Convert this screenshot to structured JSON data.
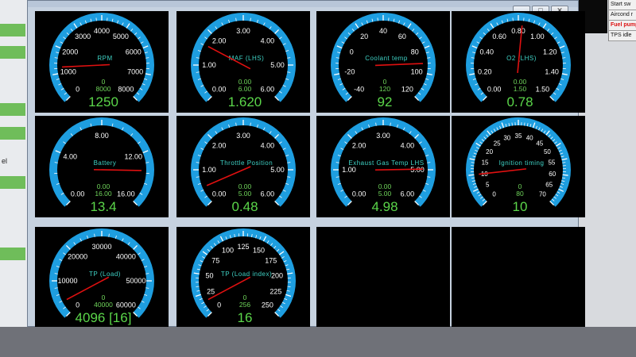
{
  "window": {
    "controls": {
      "minimize": "_",
      "maximize": "□",
      "close": "✕"
    }
  },
  "colors": {
    "gauge_ring": "#1e9ee0",
    "needle": "#e01010",
    "value_text": "#5bd64a",
    "minmax_text": "#6fd45a",
    "label_text": "#3fd3c6",
    "scale_text": "#ffffff",
    "tile_bg": "#000000"
  },
  "left_strip": {
    "items": [
      "",
      "",
      "",
      "",
      "el",
      "",
      "",
      ""
    ]
  },
  "right_table": {
    "rows": [
      {
        "text": "Start sw",
        "alert": false
      },
      {
        "text": "Aircond r",
        "alert": false
      },
      {
        "text": "Fuel pump",
        "alert": true
      },
      {
        "text": "TPS idle",
        "alert": false
      }
    ]
  },
  "gauges": [
    {
      "label": "RPM",
      "scale_labels": [
        "0",
        "1000",
        "2000",
        "3000",
        "4000",
        "5000",
        "6000",
        "7000",
        "8000"
      ],
      "min_text": "0",
      "max_text": "8000",
      "value_text": "1250",
      "min": 0,
      "max": 8000,
      "value": 1250
    },
    {
      "label": "MAF (LHS)",
      "scale_labels": [
        "0.00",
        "1.00",
        "2.00",
        "3.00",
        "4.00",
        "5.00",
        "6.00"
      ],
      "min_text": "0.00",
      "max_text": "6.00",
      "value_text": "1.620",
      "min": 0,
      "max": 6,
      "value": 1.62
    },
    {
      "label": "Coolant temp",
      "scale_labels": [
        "-40",
        "-20",
        "0",
        "20",
        "40",
        "60",
        "80",
        "100",
        "120"
      ],
      "min_text": "0",
      "max_text": "120",
      "value_text": "92",
      "min": -40,
      "max": 120,
      "value": 92
    },
    {
      "label": "O2 (LHS)",
      "scale_labels": [
        "0.00",
        "0.20",
        "0.40",
        "0.60",
        "0.80",
        "1.00",
        "1.20",
        "1.40",
        "1.50"
      ],
      "min_text": "0.00",
      "max_text": "1.50",
      "value_text": "0.78",
      "min": 0,
      "max": 1.5,
      "value": 0.78
    },
    {
      "label": "Battery",
      "scale_labels": [
        "0.00",
        "4.00",
        "8.00",
        "12.00",
        "16.00"
      ],
      "min_text": "0.00",
      "max_text": "16.00",
      "value_text": "13.4",
      "min": 0,
      "max": 16,
      "value": 13.4
    },
    {
      "label": "Throttle Position",
      "scale_labels": [
        "0.00",
        "1.00",
        "2.00",
        "3.00",
        "4.00",
        "5.00",
        "6.00"
      ],
      "min_text": "0.00",
      "max_text": "5.00",
      "value_text": "0.48",
      "min": 0,
      "max": 6,
      "value": 0.48
    },
    {
      "label": "Exhaust Gas Temp LHS",
      "scale_labels": [
        "0.00",
        "1.00",
        "2.00",
        "3.00",
        "4.00",
        "5.00",
        "6.00"
      ],
      "min_text": "0.00",
      "max_text": "5.00",
      "value_text": "4.98",
      "min": 0,
      "max": 6,
      "value": 4.98
    },
    {
      "label": "Ignition timing",
      "scale_labels": [
        "0",
        "5",
        "10",
        "15",
        "20",
        "25",
        "30",
        "35",
        "40",
        "45",
        "50",
        "55",
        "60",
        "65",
        "70"
      ],
      "min_text": "0",
      "max_text": "80",
      "value_text": "10",
      "min": 0,
      "max": 70,
      "value": 10
    },
    {
      "label": "TP (Load)",
      "scale_labels": [
        "0",
        "10000",
        "20000",
        "30000",
        "40000",
        "50000",
        "60000"
      ],
      "min_text": "0",
      "max_text": "40000",
      "value_text": "4096 [16]",
      "min": 0,
      "max": 65535,
      "value": 4096
    },
    {
      "label": "TP (Load index)",
      "scale_labels": [
        "0",
        "25",
        "50",
        "75",
        "100",
        "125",
        "150",
        "175",
        "200",
        "225",
        "250"
      ],
      "min_text": "0",
      "max_text": "256",
      "value_text": "16",
      "min": 0,
      "max": 256,
      "value": 16
    },
    {
      "empty": true
    },
    {
      "empty": true
    }
  ]
}
